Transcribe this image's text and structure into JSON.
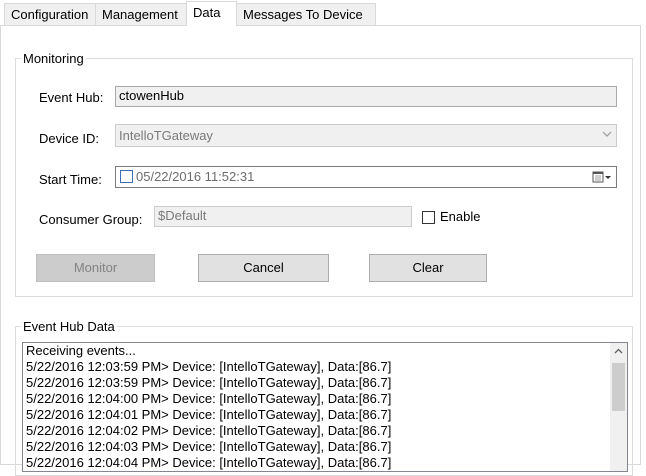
{
  "tabs": [
    {
      "label": "Configuration",
      "active": false
    },
    {
      "label": "Management",
      "active": false
    },
    {
      "label": "Data",
      "active": true
    },
    {
      "label": "Messages To Device",
      "active": false
    }
  ],
  "monitoring": {
    "group_title": "Monitoring",
    "event_hub_label": "Event Hub:",
    "event_hub_value": "ctowenHub",
    "device_id_label": "Device ID:",
    "device_id_value": "IntelloTGateway",
    "start_time_label": "Start Time:",
    "start_time_value": "05/22/2016 11:52:31",
    "start_time_checked": false,
    "consumer_group_label": "Consumer Group:",
    "consumer_group_value": "$Default",
    "enable_label": "Enable",
    "enable_checked": false,
    "buttons": {
      "monitor": "Monitor",
      "cancel": "Cancel",
      "clear": "Clear"
    }
  },
  "event_hub_data": {
    "group_title": "Event Hub Data",
    "lines": [
      "Receiving events...",
      "5/22/2016 12:03:59 PM> Device: [IntelloTGateway], Data:[86.7]",
      "5/22/2016 12:03:59 PM> Device: [IntelloTGateway], Data:[86.7]",
      "5/22/2016 12:04:00 PM> Device: [IntelloTGateway], Data:[86.7]",
      "5/22/2016 12:04:01 PM> Device: [IntelloTGateway], Data:[86.7]",
      "5/22/2016 12:04:02 PM> Device: [IntelloTGateway], Data:[86.7]",
      "5/22/2016 12:04:03 PM> Device: [IntelloTGateway], Data:[86.7]",
      "5/22/2016 12:04:04 PM> Device: [IntelloTGateway], Data:[86.7]"
    ]
  }
}
